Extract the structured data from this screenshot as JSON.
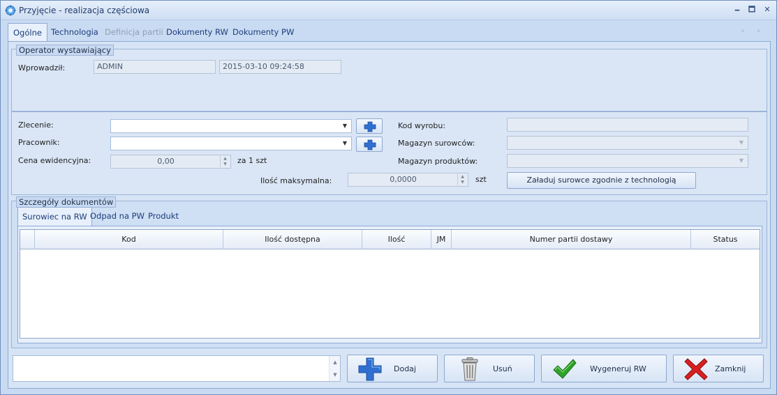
{
  "window": {
    "title": "Przyjęcie - realizacja częściowa",
    "minimize_glyph": "🗕",
    "maximize_glyph": "🗖",
    "close_glyph": "✕"
  },
  "tabs": [
    {
      "label": "Ogólne",
      "active": true
    },
    {
      "label": "Technologia"
    },
    {
      "label": "Definicja partii",
      "disabled": true
    },
    {
      "label": "Dokumenty RW"
    },
    {
      "label": "Dokumenty PW"
    }
  ],
  "tab_scroll": "◂ ▸",
  "operator": {
    "group_title": "Operator wystawiający",
    "entered_by_label": "Wprowadził:",
    "entered_by_value": "ADMIN",
    "entered_date_value": "2015-03-10 09:24:58"
  },
  "form": {
    "order_label": "Zlecenie:",
    "order_value": "",
    "worker_label": "Pracownik:",
    "worker_value": "",
    "price_label": "Cena ewidencyjna:",
    "price_value": "0,00",
    "price_unit": "za 1 szt",
    "max_qty_label": "Ilość maksymalna:",
    "max_qty_value": "0,0000",
    "max_qty_unit": "szt",
    "product_code_label": "Kod wyrobu:",
    "product_code_value": "",
    "raw_warehouse_label": "Magazyn surowców:",
    "raw_warehouse_value": "",
    "product_warehouse_label": "Magazyn produktów:",
    "product_warehouse_value": "",
    "load_button": "Załaduj surowce zgodnie z technologią"
  },
  "details": {
    "group_title": "Szczegóły dokumentów",
    "tabs": [
      {
        "label": "Surowiec na RW",
        "active": true
      },
      {
        "label": "Odpad na PW"
      },
      {
        "label": "Produkt"
      }
    ],
    "columns": [
      "Kod",
      "Ilość dostępna",
      "Ilość",
      "JM",
      "Numer partii dostawy",
      "Status"
    ],
    "rows": []
  },
  "footer": {
    "note_value": "",
    "add_button": "Dodaj",
    "remove_button": "Usuń",
    "generate_button": "Wygeneruj RW",
    "close_button": "Zamknij"
  },
  "colors": {
    "accent_blue": "#2f6fd1",
    "ok_green": "#2fa32a",
    "close_red": "#d82020"
  }
}
